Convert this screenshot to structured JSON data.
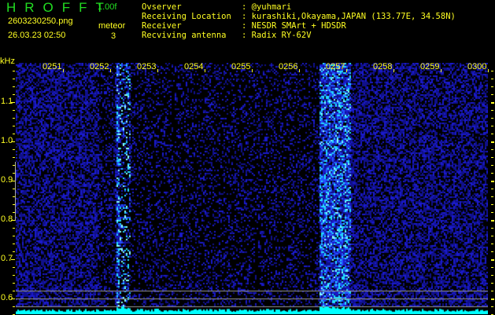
{
  "header": {
    "app_name": "HROFFT",
    "version": "1.00f",
    "filename": "2603230250.png",
    "datetime": "26.03.23 02:50",
    "meteor_label": "meteor",
    "meteor_count": "3"
  },
  "info": [
    {
      "label": "Ovserver",
      "value": "@yuhmari"
    },
    {
      "label": "Receiving Location",
      "value": "kurashiki,Okayama,JAPAN (133.77E, 34.58N)"
    },
    {
      "label": "Receiver",
      "value": "NESDR SMArt + HDSDR"
    },
    {
      "label": "Recviving antenna",
      "value": "Radix RY-62V"
    }
  ],
  "axis": {
    "unit": "kHz",
    "time_labels": [
      "0251",
      "0252",
      "0253",
      "0254",
      "0255",
      "0256",
      "0257",
      "0258",
      "0259",
      "0300"
    ],
    "freq_labels": [
      "1.1",
      "1.0",
      "0.9",
      "0.8",
      "0.7",
      "0.6"
    ]
  },
  "colors": {
    "logo": "#22dd22",
    "text": "#ffff22",
    "spectrum": "#00ffff"
  }
}
